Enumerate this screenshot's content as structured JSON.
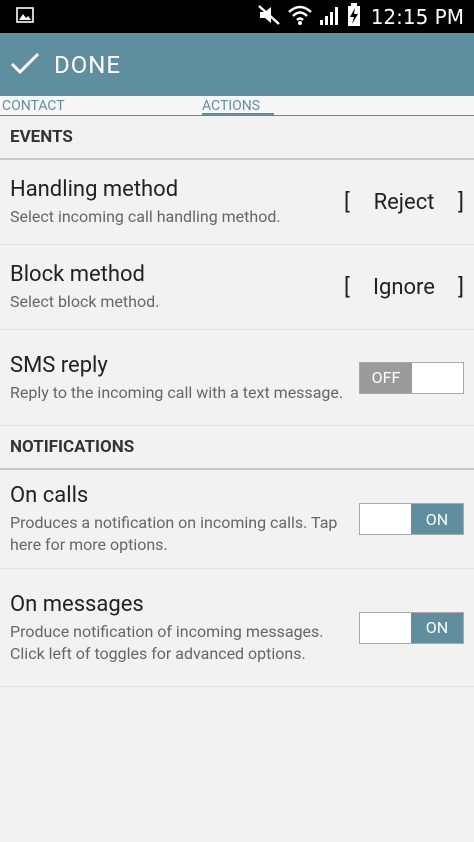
{
  "status": {
    "time": "12:15 PM"
  },
  "action_bar": {
    "done_label": "DONE"
  },
  "tabs": [
    {
      "label": "CONTACT",
      "active": false
    },
    {
      "label": "ACTIONS",
      "active": true
    }
  ],
  "events": {
    "header": "EVENTS",
    "handling": {
      "title": "Handling method",
      "summary": "Select incoming call handling method.",
      "value": "Reject",
      "bracket_open": "[",
      "bracket_close": "]"
    },
    "block": {
      "title": "Block method",
      "summary": "Select block method.",
      "value": "Ignore",
      "bracket_open": "[",
      "bracket_close": "]"
    },
    "sms": {
      "title": "SMS reply",
      "summary": "Reply to the incoming call with a text message.",
      "toggle_label": "OFF",
      "state": "off"
    }
  },
  "notifications": {
    "header": "NOTIFICATIONS",
    "calls": {
      "title": "On calls",
      "summary": "Produces a notification on incoming calls. Tap here for more options.",
      "toggle_label": "ON",
      "state": "on"
    },
    "messages": {
      "title": "On messages",
      "summary": "Produce notification of incoming messages. Click left of toggles for advanced options.",
      "toggle_label": "ON",
      "state": "on"
    }
  },
  "colors": {
    "accent": "#5f8f9f",
    "toggle_off": "#9b9b9b"
  }
}
